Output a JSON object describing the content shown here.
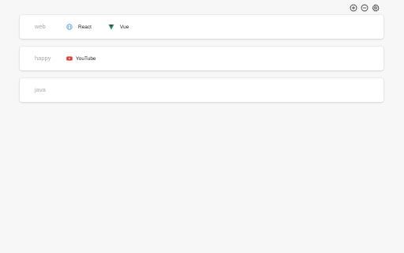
{
  "toolbar": {
    "buttons": [
      {
        "icon": "add-circle-icon"
      },
      {
        "icon": "remove-circle-icon"
      },
      {
        "icon": "gear-icon"
      }
    ]
  },
  "groups": [
    {
      "name": "web",
      "links": [
        {
          "label": "React",
          "icon": "globe-icon"
        },
        {
          "label": "Vue",
          "icon": "vue-logo-icon"
        }
      ]
    },
    {
      "name": "happy",
      "links": [
        {
          "label": "YouTube",
          "icon": "youtube-icon"
        }
      ]
    },
    {
      "name": "java",
      "links": []
    }
  ],
  "colors": {
    "background": "#f7f7f7",
    "card": "#ffffff",
    "group_label": "#a8a8a8",
    "vue_green": "#2f8a5f",
    "youtube_red": "#e53935",
    "globe_blue": "#6aa6d8"
  }
}
